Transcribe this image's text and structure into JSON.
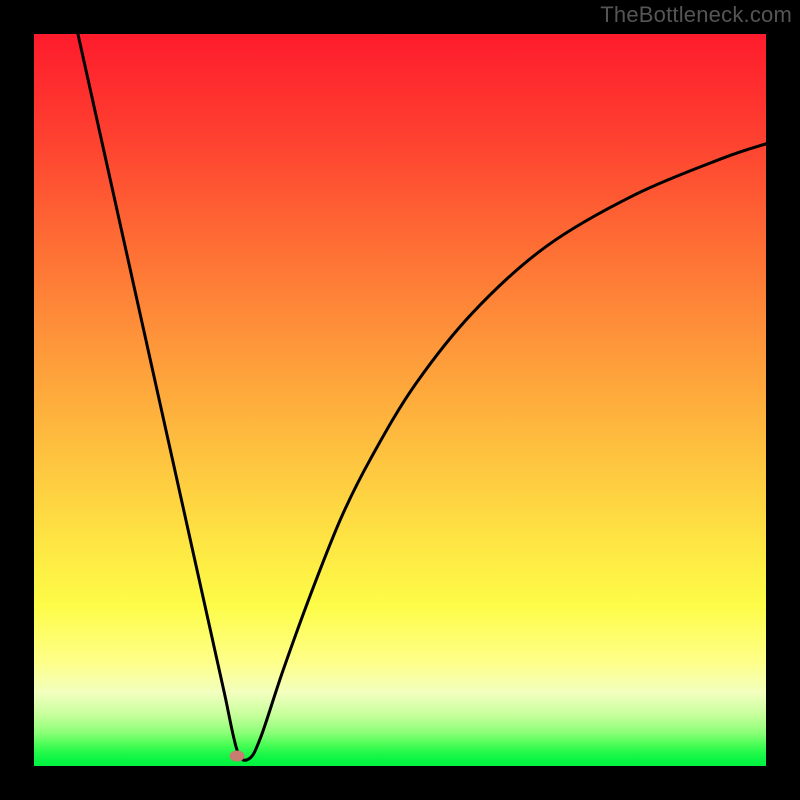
{
  "attribution": "TheBottleneck.com",
  "colors": {
    "gradient_top": "#fe1b2c",
    "gradient_bottom": "#02f141",
    "curve": "#000000",
    "marker": "#c77d6f",
    "frame": "#000000",
    "attribution_text": "#555555"
  },
  "chart_data": {
    "type": "line",
    "title": "",
    "xlabel": "",
    "ylabel": "",
    "xlim": [
      0,
      100
    ],
    "ylim": [
      0,
      100
    ],
    "grid": false,
    "series": [
      {
        "name": "bottleneck-curve",
        "x": [
          6,
          8,
          10,
          12,
          14,
          16,
          18,
          20,
          22,
          24,
          26,
          27.8,
          29.4,
          31,
          34,
          38,
          42,
          46,
          52,
          60,
          70,
          82,
          94,
          100
        ],
        "y": [
          100,
          91,
          82,
          73,
          64,
          55,
          46,
          37,
          28,
          19,
          10,
          2,
          1,
          4,
          13,
          24,
          34,
          42,
          52,
          62,
          71,
          78,
          83,
          85
        ]
      }
    ],
    "marker": {
      "x": 27.8,
      "y": 1.4
    },
    "legend": false
  }
}
